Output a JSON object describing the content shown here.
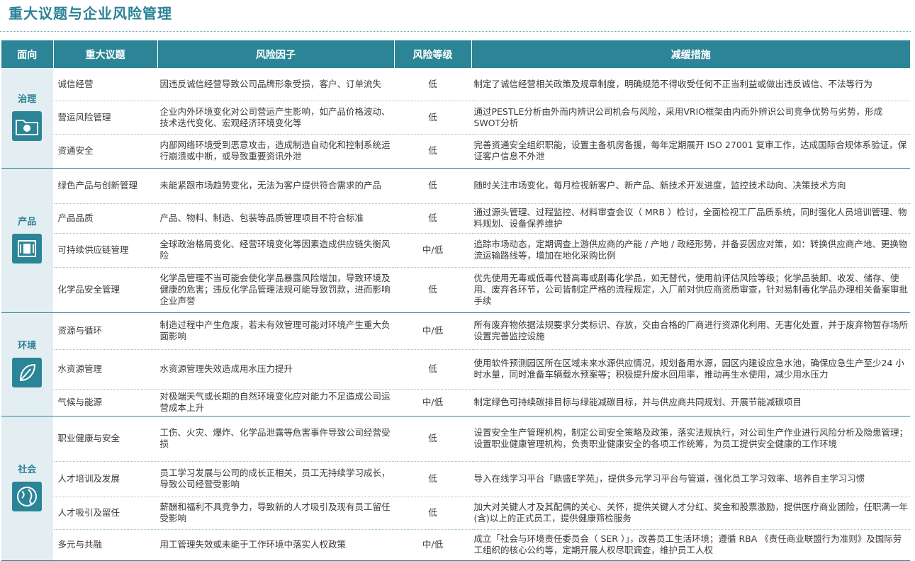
{
  "page_title": "重大议题与企业风险管理",
  "headers": {
    "dimension": "面向",
    "topic": "重大议题",
    "risk_factor": "风险因子",
    "risk_level": "风险等级",
    "mitigation": "减缓措施"
  },
  "groups": [
    {
      "dimension": "治理",
      "icon": "folder-globe-icon",
      "rows": [
        {
          "topic": "诚信经营",
          "risk": "因违反诚信经营导致公司品牌形象受损，客户、订单流失",
          "level": "低",
          "mitigation": "制定了诚信经营相关政策及规章制度，明确规范不得收受任何不正当利益或做出违反诚信、不法等行为"
        },
        {
          "topic": "营运风险管理",
          "risk": "企业内外环境变化对公司营运产生影响，如产品价格波动、技术迭代变化、宏观经济环境变化等",
          "level": "低",
          "mitigation": "通过PESTLE分析由外而内辨识公司机会与风险，采用VRIO框架由内而外辨识公司竞争优势与劣势，形成SWOT分析"
        },
        {
          "topic": "资通安全",
          "risk": "内部网络环境受到恶意攻击，造成制造自动化和控制系统运行崩溃或中断，或导致重要资讯外泄",
          "level": "低",
          "mitigation": "完善资通安全组织职能，设置主备机房备援，每年定期展开 ISO 27001 复审工作，达成国际合规体系验证，保证客户信息不外泄"
        }
      ]
    },
    {
      "dimension": "产品",
      "icon": "chip-icon",
      "rows": [
        {
          "topic": "绿色产品与创新管理",
          "risk": "未能紧跟市场趋势变化，无法为客户提供符合需求的产品",
          "level": "低",
          "mitigation": "随时关注市场变化，每月检视新客户、新产品、新技术开发进度，监控技术动向、决策技术方向"
        },
        {
          "topic": "产品品质",
          "risk": "产品、物料、制造、包装等品质管理项目不符合标准",
          "level": "低",
          "mitigation": "通过源头管理、过程监控、材料审查会议（ MRB ）检讨，全面检视工厂品质系统，同时强化人员培训管理、物料规划、设备保养维护"
        },
        {
          "topic": "可持续供应链管理",
          "risk": "全球政治格局变化、经营环境变化等因素造成供应链失衡风险",
          "level": "中/低",
          "mitigation": "追踪市场动态，定期调查上游供应商的产能 / 产地 / 政经形势，并备妥因应对策，如：转换供应商产地、更换物流运输路线等，增加在地化采购比例"
        },
        {
          "topic": "化学品安全管理",
          "risk": "化学品管理不当可能会使化学品暴露风险增加，导致环境及健康的危害；违反化学品管理法规可能导致罚款，进而影响企业声誉",
          "level": "低",
          "mitigation": "优先使用无毒或低毒代替高毒或剧毒化学品，如无替代，使用前评估风险等级；化学品装卸、收发、储存、使用、废弃各环节，公司皆制定严格的流程规定，入厂前对供应商资质审查，针对易制毒化学品办理相关备案审批手续"
        }
      ]
    },
    {
      "dimension": "环境",
      "icon": "leaf-icon",
      "rows": [
        {
          "topic": "资源与循环",
          "risk": "制造过程中产生危废，若未有效管理可能对环境产生重大负面影响",
          "level": "中/低",
          "mitigation": "所有废弃物依据法规要求分类标识、存放，交由合格的厂商进行资源化利用、无害化处置，并于废弃物暂存场所设置完善监控设施"
        },
        {
          "topic": "水资源管理",
          "risk": "水资源管理失效造成用水压力提升",
          "level": "低",
          "mitigation": "使用软件预测园区所在区域未来水源供应情况，规划备用水源，园区内建设应急水池，确保应急生产至少24 小时水量，同时准备车辆载水预案等；积极提升废水回用率，推动再生水使用，减少用水压力"
        },
        {
          "topic": "气候与能源",
          "risk": "对极端天气或长期的自然环境变化应对能力不足造成公司运营成本上升",
          "level": "中/低",
          "mitigation": "制定绿色可持续碳排目标与绿能减碳目标，并与供应商共同规划、开展节能减碳项目"
        }
      ]
    },
    {
      "dimension": "社会",
      "icon": "globe-icon",
      "rows": [
        {
          "topic": "职业健康与安全",
          "risk": "工伤、火灾、爆炸、化学品泄露等危害事件导致公司经营受损",
          "level": "低",
          "mitigation": "设置安全生产管理机构，制定公司安全策略及政策，落实法规执行，对公司生产作业进行风险分析及隐患管理；设置职业健康管理机构，负责职业健康安全的各项工作统筹，为员工提供安全健康的工作环境"
        },
        {
          "topic": "人才培训及发展",
          "risk": "员工学习发展与公司的成长正相关，员工无持续学习成长，导致公司经营受影响",
          "level": "低",
          "mitigation": "导入在线学习平台「鼎盛E学苑」，提供多元学习平台与管道，强化员工学习效率、培养自主学习习惯"
        },
        {
          "topic": "人才吸引及留任",
          "risk": "薪酬和福利不具竞争力，导致新的人才吸引及现有员工留任受影响",
          "level": "低",
          "mitigation": "加大对关键人才及其配偶的关心、关怀，提供关键人才分红、奖金和股票激励，提供医疗商业团险，任职满一年(含)以上的正式员工，提供健康筛检服务"
        },
        {
          "topic": "多元与共融",
          "risk": "用工管理失效或未能于工作环境中落实人权政策",
          "level": "中/低",
          "mitigation": "成立「社会与环境责任委员会（ SER ）」，改善员工生活环境；遵循 RBA 《责任商业联盟行为准则》及国际劳工组织的核心公约等，定期开展人权尽职调查，维护员工人权"
        }
      ]
    }
  ]
}
